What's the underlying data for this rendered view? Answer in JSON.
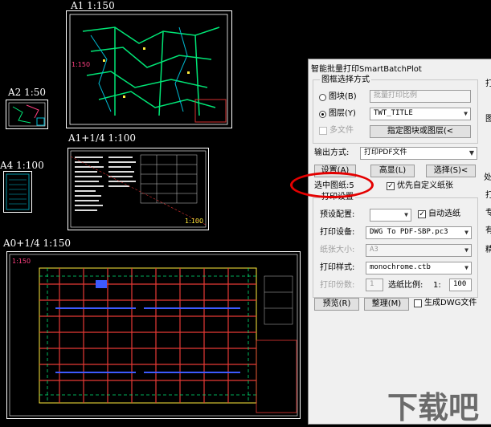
{
  "drawings": {
    "a1_label": "A1 1:150",
    "a2_label": "A2 1:50",
    "a4_label": "A4 1:100",
    "a1q_label": "A1+1/4 1:100",
    "a0q_label": "A0+1/4  1:150",
    "a1_scale_mark": "1:150",
    "a1q_scale_mark": "1:100",
    "a0q_scale_mark": "1:150"
  },
  "dialog": {
    "title": "智能批量打印SmartBatchPlot",
    "frame_group": "图框选择方式",
    "block_radio": "图块(B)",
    "block_field": "批量打印比例",
    "layer_radio": "图层(Y)",
    "layer_value": "TWT_TITLE",
    "multi_file": "多文件",
    "specify_block_button": "指定图块或图层(<",
    "output_label": "输出方式:",
    "output_value": "打印PDF文件",
    "settings_button": "设置(A)",
    "highlight_button": "高显(L)",
    "select_button": "选择(S)<",
    "selected_sheets": "选中图纸:5",
    "custom_paper": "优先自定义纸张",
    "print_settings_group": "打印设置",
    "preset_label": "预设配置:",
    "auto_select": "自动选纸",
    "printer_label": "打印设备:",
    "printer_value": "DWG To PDF-SBP.pc3",
    "paper_size_label": "纸张大小:",
    "paper_size_value": "A3",
    "style_label": "打印样式:",
    "style_value": "monochrome.ctb",
    "copies_label": "打印份数:",
    "copies_value": "1",
    "scale_label": "选纸比例:",
    "scale_prefix": "1:",
    "scale_value": "100",
    "preview_button": "预览(R)",
    "organize_button": "整理(M)",
    "gen_dwg": "生成DWG文件"
  },
  "right_glyphs": [
    "打",
    "图",
    "处",
    "打",
    "专",
    "有",
    "精"
  ],
  "watermark": "下载吧"
}
